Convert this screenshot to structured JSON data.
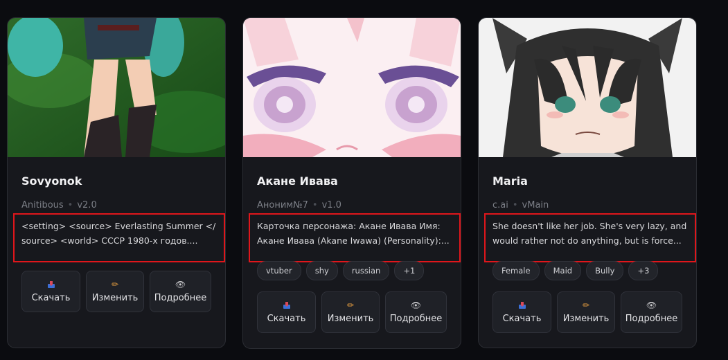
{
  "cards": [
    {
      "name": "Sovyonok",
      "author": "Anitibous",
      "version": "v2.0",
      "description": "<setting> <source> Everlasting Summer </ source> <world> СССР 1980-х годов....",
      "tags": [],
      "image_icon": "character-portrait-image"
    },
    {
      "name": "Акане Ивава",
      "author": "Аноним№7",
      "version": "v1.0",
      "description": "Карточка персонажа: Акане Ивава Имя: Акане Ивава (Akane Iwawa) (Personality):...",
      "tags": [
        "vtuber",
        "shy",
        "russian",
        "+1"
      ],
      "image_icon": "character-portrait-image"
    },
    {
      "name": "Maria",
      "author": "c.ai",
      "version": "vMain",
      "description": "She doesn't like her job. She's very lazy, and would rather not do anything, but is force...",
      "tags": [
        "Female",
        "Maid",
        "Bully",
        "+3"
      ],
      "image_icon": "character-portrait-image"
    }
  ],
  "actions": {
    "download_label": "Скачать",
    "edit_label": "Изменить",
    "details_label": "Подробнее",
    "download_icon": "inbox-tray-icon",
    "edit_icon": "pencil-icon",
    "details_icon": "eye-icon"
  },
  "colors": {
    "page_background": "#0b0c10",
    "card_background": "#17181d",
    "highlight_border": "#e0161b",
    "muted_text": "#7c7f87"
  }
}
